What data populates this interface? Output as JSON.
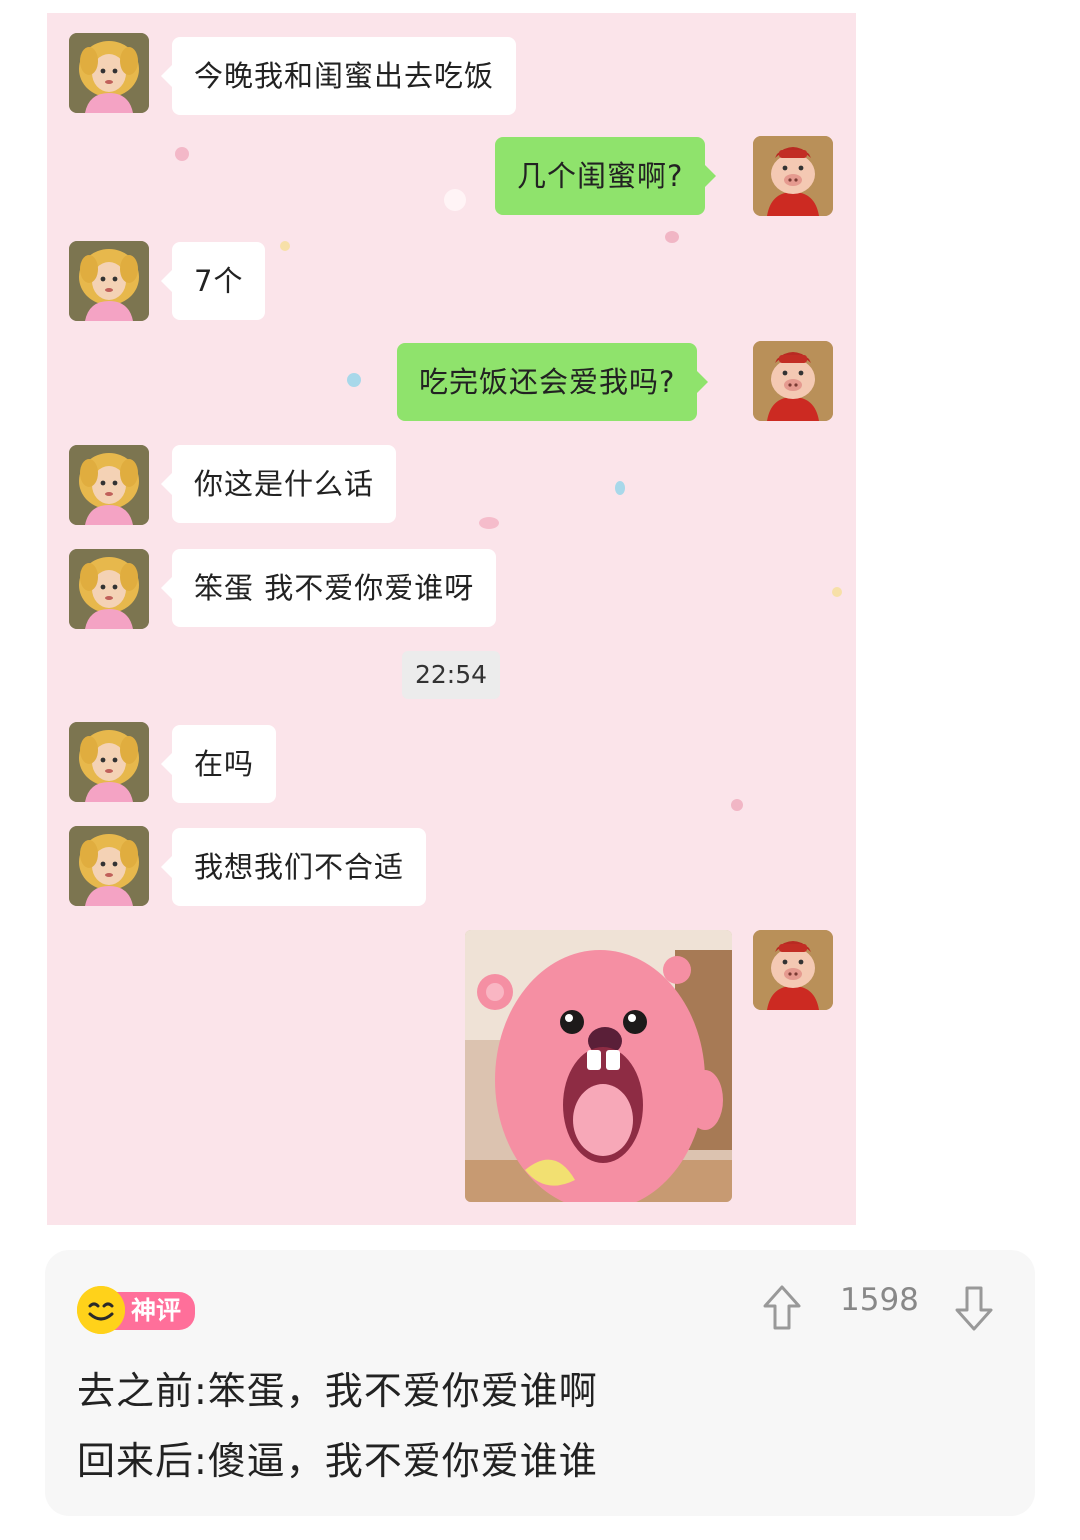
{
  "chat": {
    "messages": [
      {
        "side": "left",
        "text": "今晚我和闺蜜出去吃饭"
      },
      {
        "side": "right",
        "text": "几个闺蜜啊?"
      },
      {
        "side": "left",
        "text": "7个"
      },
      {
        "side": "right",
        "text": "吃完饭还会爱我吗?"
      },
      {
        "side": "left",
        "text": "你这是什么话"
      },
      {
        "side": "left",
        "text": "笨蛋 我不爱你爱谁呀"
      },
      {
        "side": "left",
        "text": "在吗"
      },
      {
        "side": "left",
        "text": "我想我们不合适"
      }
    ],
    "timestamp": "22:54",
    "sticker": "pink-beaver-screaming-sticker"
  },
  "comment": {
    "badge_label": "神评",
    "vote_count": "1598",
    "lines": [
      "去之前:笨蛋，我不爱你爱谁啊",
      "回来后:傻逼，我不爱你爱谁谁"
    ]
  },
  "colors": {
    "chat_background": "#fbe4ea",
    "sent_bubble": "#8fe36c",
    "received_bubble": "#ffffff",
    "badge_pink": "#ff6f9a",
    "badge_yellow": "#ffd21a"
  }
}
